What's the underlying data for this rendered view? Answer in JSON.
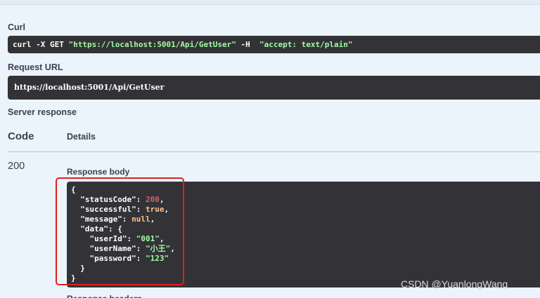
{
  "curl": {
    "label": "Curl",
    "command": "curl -X GET ",
    "url": "\"https://localhost:5001/Api/GetUser\"",
    "flag": " -H  ",
    "header": "\"accept: text/plain\""
  },
  "request_url": {
    "label": "Request URL",
    "value": "https://localhost:5001/Api/GetUser"
  },
  "server_response": {
    "label": "Server response",
    "col_code": "Code",
    "col_details": "Details",
    "status_code": "200",
    "response_body_label": "Response body",
    "next_label": "Response headers",
    "body": {
      "statusCode": "200",
      "successful": "true",
      "message": "null",
      "userId": "\"001\"",
      "userName": "\"小王\"",
      "password": "\"123\""
    }
  },
  "watermark": "CSDN @YuanlongWang",
  "colors": {
    "background": "#ebf3fb",
    "code_block": "#333337",
    "string": "#a2fca2",
    "number": "#d36363",
    "keyword": "#fcc28c",
    "highlight_box": "#e02020"
  }
}
